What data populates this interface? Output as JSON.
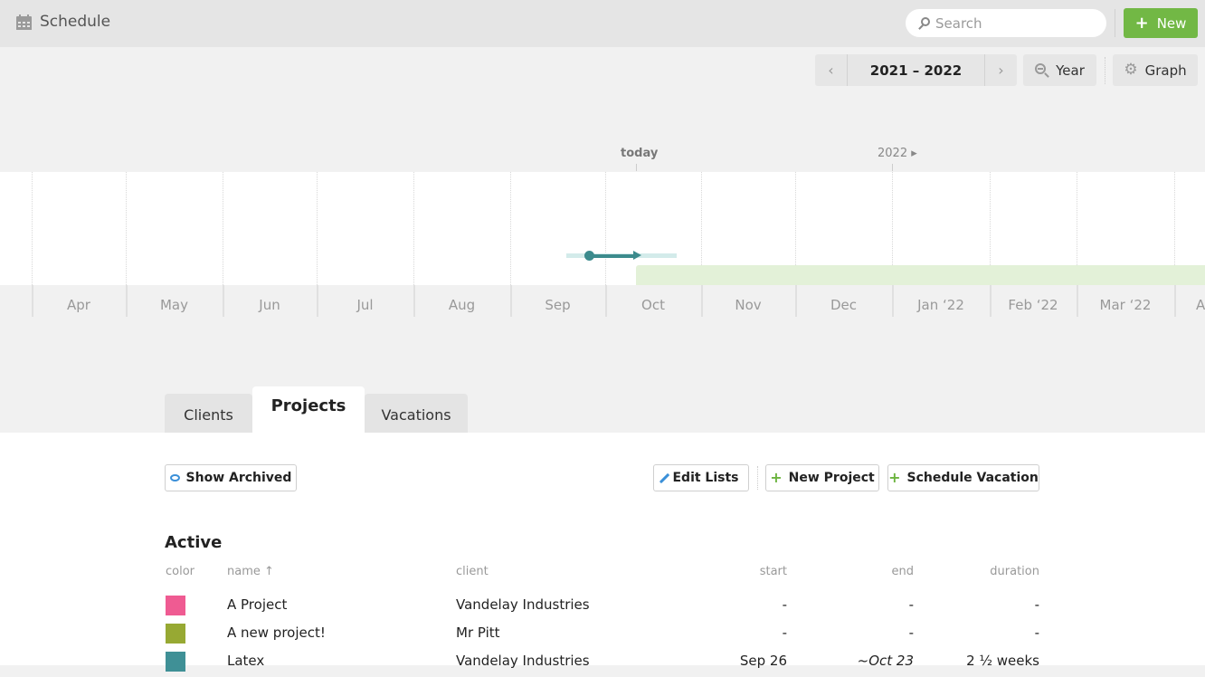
{
  "header": {
    "title": "Schedule",
    "title_icon": "calendar-icon",
    "search": {
      "placeholder": "Search",
      "value": "",
      "icon": "search-icon"
    },
    "new_button": {
      "label": "New",
      "icon": "plus-icon",
      "color": "#72b845"
    }
  },
  "controls": {
    "prev_icon": "‹",
    "range_label": "2021 – 2022",
    "next_icon": "›",
    "zoom_label": "Year",
    "zoom_icon": "zoom-out-icon",
    "view_label": "Graph",
    "view_icon": "gear-icon"
  },
  "timeline": {
    "today_label": "today",
    "year_marker": "2022 ▸",
    "months": [
      "Apr",
      "May",
      "Jun",
      "Jul",
      "Aug",
      "Sep",
      "Oct",
      "Nov",
      "Dec",
      "Jan ‘22",
      "Feb ‘22",
      "Mar ‘22",
      "A"
    ],
    "project_color": "#3c8b8d",
    "vacation_color": "#e3f1d8"
  },
  "tabs": [
    {
      "label": "Clients",
      "active": false
    },
    {
      "label": "Projects",
      "active": true
    },
    {
      "label": "Vacations",
      "active": false
    }
  ],
  "actions": {
    "show_archived": "Show Archived",
    "edit_lists": "Edit Lists",
    "new_project": "New Project",
    "schedule_vacation": "Schedule Vacation"
  },
  "projects": {
    "section_title": "Active",
    "columns": {
      "color": "color",
      "name": "name ↑",
      "client": "client",
      "start": "start",
      "end": "end",
      "duration": "duration"
    },
    "rows": [
      {
        "color": "#ef5b92",
        "name": "A Project",
        "client": "Vandelay Industries",
        "start": "-",
        "end": "-",
        "duration": "-"
      },
      {
        "color": "#97a933",
        "name": "A new project!",
        "client": "Mr Pitt",
        "start": "-",
        "end": "-",
        "duration": "-"
      },
      {
        "color": "#3f9096",
        "name": "Latex",
        "client": "Vandelay Industries",
        "start": "Sep 26",
        "end": "~Oct 23",
        "duration": "2 ½ weeks"
      }
    ]
  }
}
